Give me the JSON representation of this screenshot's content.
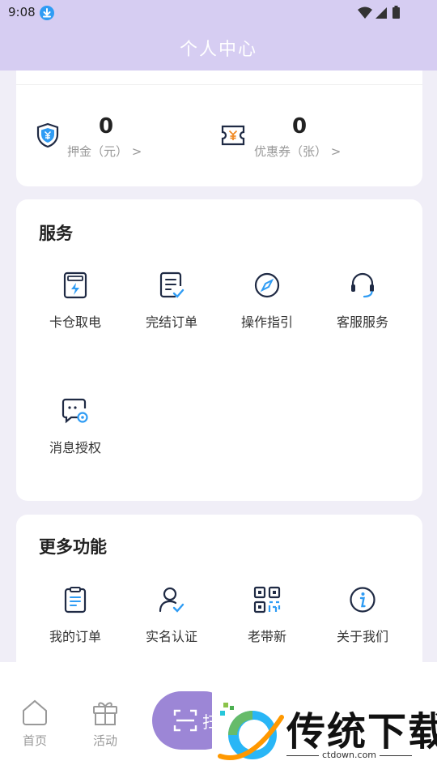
{
  "status_bar": {
    "time": "9:08"
  },
  "header": {
    "title": "个人中心"
  },
  "wallet": {
    "deposit": {
      "value": "0",
      "label": "押金（元）",
      "arrow": ">"
    },
    "coupon": {
      "value": "0",
      "label": "优惠券（张）",
      "arrow": ">"
    }
  },
  "services": {
    "title": "服务",
    "items": [
      {
        "label": "卡仓取电",
        "icon": "battery-cabinet-icon"
      },
      {
        "label": "完结订单",
        "icon": "order-complete-icon"
      },
      {
        "label": "操作指引",
        "icon": "compass-icon"
      },
      {
        "label": "客服服务",
        "icon": "headset-icon"
      },
      {
        "label": "消息授权",
        "icon": "message-settings-icon"
      }
    ]
  },
  "more": {
    "title": "更多功能",
    "items": [
      {
        "label": "我的订单",
        "icon": "clipboard-icon"
      },
      {
        "label": "实名认证",
        "icon": "user-verified-icon"
      },
      {
        "label": "老带新",
        "icon": "qr-code-icon"
      },
      {
        "label": "关于我们",
        "icon": "info-icon"
      }
    ]
  },
  "tabbar": {
    "home": "首页",
    "activity": "活动",
    "scan_partial": "扫"
  },
  "watermark": {
    "brand": "传统下载",
    "url": "ctdown.com"
  },
  "colors": {
    "accent": "#9c86d6",
    "header": "#d6cdf2",
    "icon_blue": "#2f9cf4",
    "icon_dark": "#1f2a44"
  }
}
